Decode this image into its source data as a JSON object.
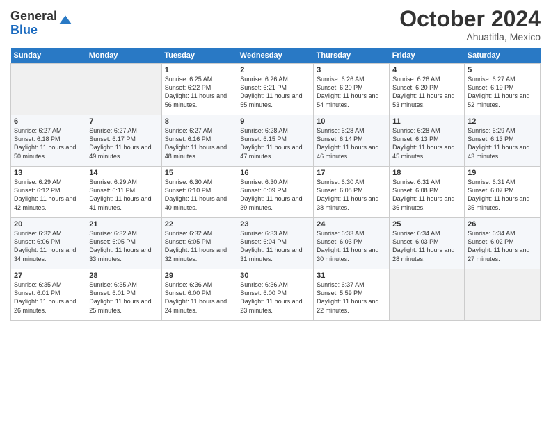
{
  "header": {
    "logo_line1": "General",
    "logo_line2": "Blue",
    "month": "October 2024",
    "location": "Ahuatitla, Mexico"
  },
  "weekdays": [
    "Sunday",
    "Monday",
    "Tuesday",
    "Wednesday",
    "Thursday",
    "Friday",
    "Saturday"
  ],
  "weeks": [
    [
      {
        "day": "",
        "sunrise": "",
        "sunset": "",
        "daylight": ""
      },
      {
        "day": "",
        "sunrise": "",
        "sunset": "",
        "daylight": ""
      },
      {
        "day": "1",
        "sunrise": "Sunrise: 6:25 AM",
        "sunset": "Sunset: 6:22 PM",
        "daylight": "Daylight: 11 hours and 56 minutes."
      },
      {
        "day": "2",
        "sunrise": "Sunrise: 6:26 AM",
        "sunset": "Sunset: 6:21 PM",
        "daylight": "Daylight: 11 hours and 55 minutes."
      },
      {
        "day": "3",
        "sunrise": "Sunrise: 6:26 AM",
        "sunset": "Sunset: 6:20 PM",
        "daylight": "Daylight: 11 hours and 54 minutes."
      },
      {
        "day": "4",
        "sunrise": "Sunrise: 6:26 AM",
        "sunset": "Sunset: 6:20 PM",
        "daylight": "Daylight: 11 hours and 53 minutes."
      },
      {
        "day": "5",
        "sunrise": "Sunrise: 6:27 AM",
        "sunset": "Sunset: 6:19 PM",
        "daylight": "Daylight: 11 hours and 52 minutes."
      }
    ],
    [
      {
        "day": "6",
        "sunrise": "Sunrise: 6:27 AM",
        "sunset": "Sunset: 6:18 PM",
        "daylight": "Daylight: 11 hours and 50 minutes."
      },
      {
        "day": "7",
        "sunrise": "Sunrise: 6:27 AM",
        "sunset": "Sunset: 6:17 PM",
        "daylight": "Daylight: 11 hours and 49 minutes."
      },
      {
        "day": "8",
        "sunrise": "Sunrise: 6:27 AM",
        "sunset": "Sunset: 6:16 PM",
        "daylight": "Daylight: 11 hours and 48 minutes."
      },
      {
        "day": "9",
        "sunrise": "Sunrise: 6:28 AM",
        "sunset": "Sunset: 6:15 PM",
        "daylight": "Daylight: 11 hours and 47 minutes."
      },
      {
        "day": "10",
        "sunrise": "Sunrise: 6:28 AM",
        "sunset": "Sunset: 6:14 PM",
        "daylight": "Daylight: 11 hours and 46 minutes."
      },
      {
        "day": "11",
        "sunrise": "Sunrise: 6:28 AM",
        "sunset": "Sunset: 6:13 PM",
        "daylight": "Daylight: 11 hours and 45 minutes."
      },
      {
        "day": "12",
        "sunrise": "Sunrise: 6:29 AM",
        "sunset": "Sunset: 6:13 PM",
        "daylight": "Daylight: 11 hours and 43 minutes."
      }
    ],
    [
      {
        "day": "13",
        "sunrise": "Sunrise: 6:29 AM",
        "sunset": "Sunset: 6:12 PM",
        "daylight": "Daylight: 11 hours and 42 minutes."
      },
      {
        "day": "14",
        "sunrise": "Sunrise: 6:29 AM",
        "sunset": "Sunset: 6:11 PM",
        "daylight": "Daylight: 11 hours and 41 minutes."
      },
      {
        "day": "15",
        "sunrise": "Sunrise: 6:30 AM",
        "sunset": "Sunset: 6:10 PM",
        "daylight": "Daylight: 11 hours and 40 minutes."
      },
      {
        "day": "16",
        "sunrise": "Sunrise: 6:30 AM",
        "sunset": "Sunset: 6:09 PM",
        "daylight": "Daylight: 11 hours and 39 minutes."
      },
      {
        "day": "17",
        "sunrise": "Sunrise: 6:30 AM",
        "sunset": "Sunset: 6:08 PM",
        "daylight": "Daylight: 11 hours and 38 minutes."
      },
      {
        "day": "18",
        "sunrise": "Sunrise: 6:31 AM",
        "sunset": "Sunset: 6:08 PM",
        "daylight": "Daylight: 11 hours and 36 minutes."
      },
      {
        "day": "19",
        "sunrise": "Sunrise: 6:31 AM",
        "sunset": "Sunset: 6:07 PM",
        "daylight": "Daylight: 11 hours and 35 minutes."
      }
    ],
    [
      {
        "day": "20",
        "sunrise": "Sunrise: 6:32 AM",
        "sunset": "Sunset: 6:06 PM",
        "daylight": "Daylight: 11 hours and 34 minutes."
      },
      {
        "day": "21",
        "sunrise": "Sunrise: 6:32 AM",
        "sunset": "Sunset: 6:05 PM",
        "daylight": "Daylight: 11 hours and 33 minutes."
      },
      {
        "day": "22",
        "sunrise": "Sunrise: 6:32 AM",
        "sunset": "Sunset: 6:05 PM",
        "daylight": "Daylight: 11 hours and 32 minutes."
      },
      {
        "day": "23",
        "sunrise": "Sunrise: 6:33 AM",
        "sunset": "Sunset: 6:04 PM",
        "daylight": "Daylight: 11 hours and 31 minutes."
      },
      {
        "day": "24",
        "sunrise": "Sunrise: 6:33 AM",
        "sunset": "Sunset: 6:03 PM",
        "daylight": "Daylight: 11 hours and 30 minutes."
      },
      {
        "day": "25",
        "sunrise": "Sunrise: 6:34 AM",
        "sunset": "Sunset: 6:03 PM",
        "daylight": "Daylight: 11 hours and 28 minutes."
      },
      {
        "day": "26",
        "sunrise": "Sunrise: 6:34 AM",
        "sunset": "Sunset: 6:02 PM",
        "daylight": "Daylight: 11 hours and 27 minutes."
      }
    ],
    [
      {
        "day": "27",
        "sunrise": "Sunrise: 6:35 AM",
        "sunset": "Sunset: 6:01 PM",
        "daylight": "Daylight: 11 hours and 26 minutes."
      },
      {
        "day": "28",
        "sunrise": "Sunrise: 6:35 AM",
        "sunset": "Sunset: 6:01 PM",
        "daylight": "Daylight: 11 hours and 25 minutes."
      },
      {
        "day": "29",
        "sunrise": "Sunrise: 6:36 AM",
        "sunset": "Sunset: 6:00 PM",
        "daylight": "Daylight: 11 hours and 24 minutes."
      },
      {
        "day": "30",
        "sunrise": "Sunrise: 6:36 AM",
        "sunset": "Sunset: 6:00 PM",
        "daylight": "Daylight: 11 hours and 23 minutes."
      },
      {
        "day": "31",
        "sunrise": "Sunrise: 6:37 AM",
        "sunset": "Sunset: 5:59 PM",
        "daylight": "Daylight: 11 hours and 22 minutes."
      },
      {
        "day": "",
        "sunrise": "",
        "sunset": "",
        "daylight": ""
      },
      {
        "day": "",
        "sunrise": "",
        "sunset": "",
        "daylight": ""
      }
    ]
  ]
}
